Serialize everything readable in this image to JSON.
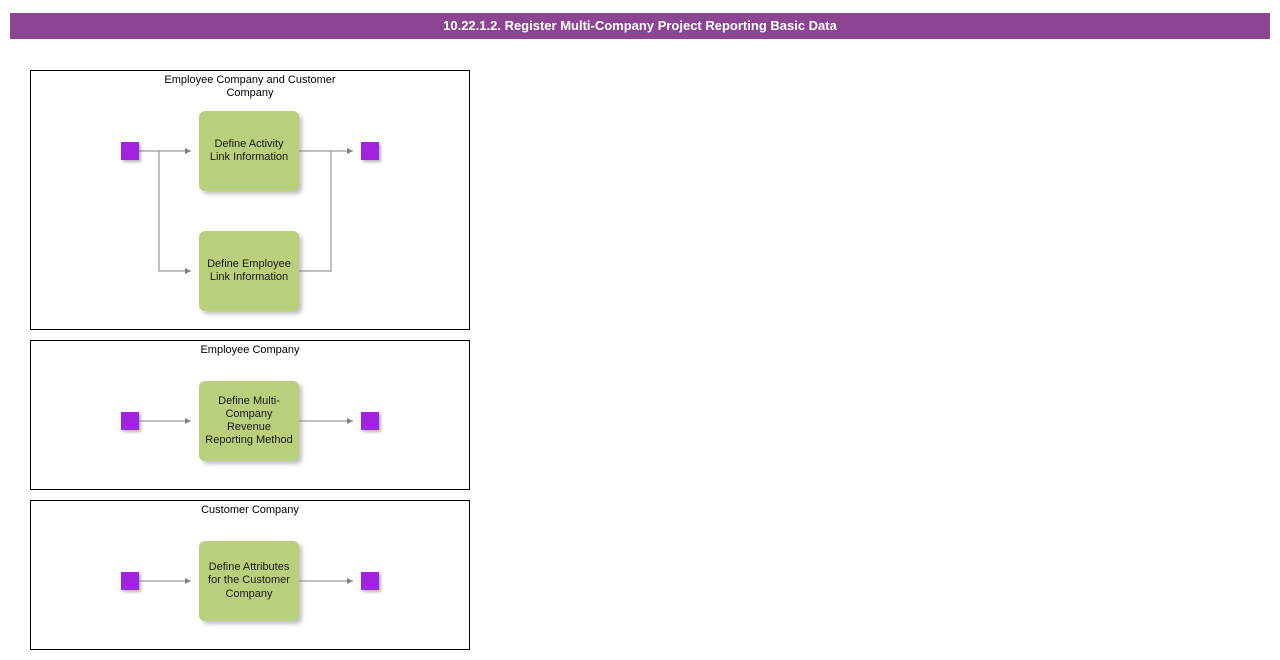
{
  "header": {
    "title": "10.22.1.2. Register Multi-Company Project Reporting Basic Data"
  },
  "lanes": {
    "lane1": {
      "title": "Employee Company and Customer Company",
      "activity1": "Define Activity Link Information",
      "activity2": "Define Employee Link Information"
    },
    "lane2": {
      "title": "Employee Company",
      "activity1": "Define Multi-Company Revenue Reporting Method"
    },
    "lane3": {
      "title": "Customer Company",
      "activity1": "Define Attributes for the Customer Company"
    }
  }
}
